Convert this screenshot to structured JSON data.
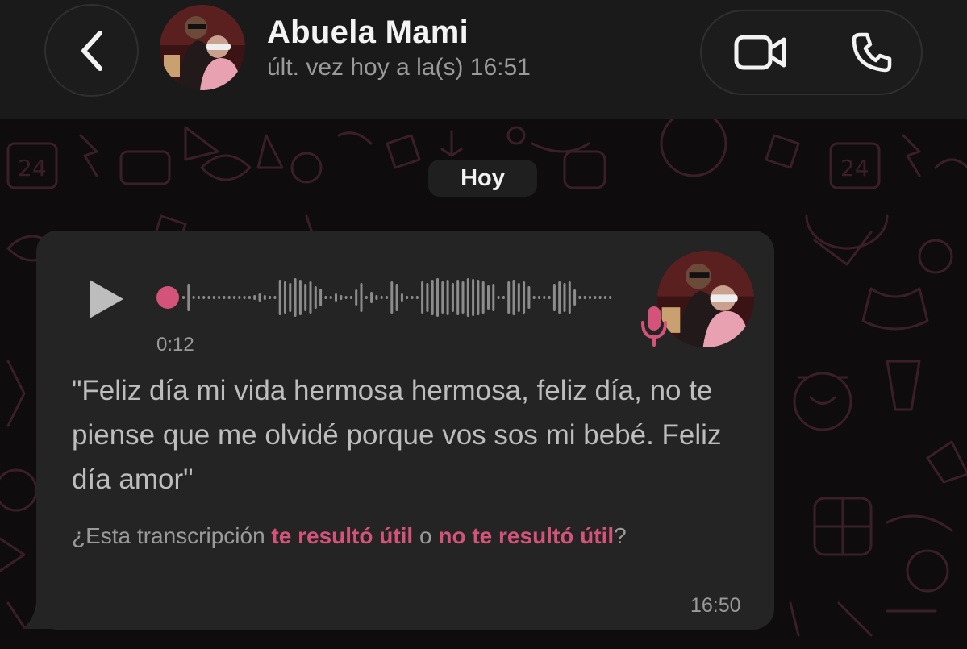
{
  "header": {
    "contact_name": "Abuela Mami",
    "last_seen": "últ. vez hoy a la(s) 16:51",
    "icons": {
      "back": "chevron-left-icon",
      "video": "video-camera-icon",
      "call": "phone-icon"
    }
  },
  "chat": {
    "date_chip": "Hoy",
    "message": {
      "type": "voice-note",
      "duration": "0:12",
      "progress": 0,
      "transcript": "\"Feliz día mi vida hermosa hermosa, feliz día, no te piense que me olvidé porque vos sos mi bebé. Feliz día amor\"",
      "feedback": {
        "prefix": "¿Esta transcripción ",
        "useful_link": "te resultó útil",
        "middle": " o ",
        "not_useful_link": "no te resultó útil",
        "suffix": "?"
      },
      "time": "16:50"
    }
  },
  "colors": {
    "accent": "#d4537a",
    "background": "#0f0c0d",
    "header": "#1a1a1a",
    "bubble": "#242424",
    "muted_text": "#9a9a9a"
  }
}
